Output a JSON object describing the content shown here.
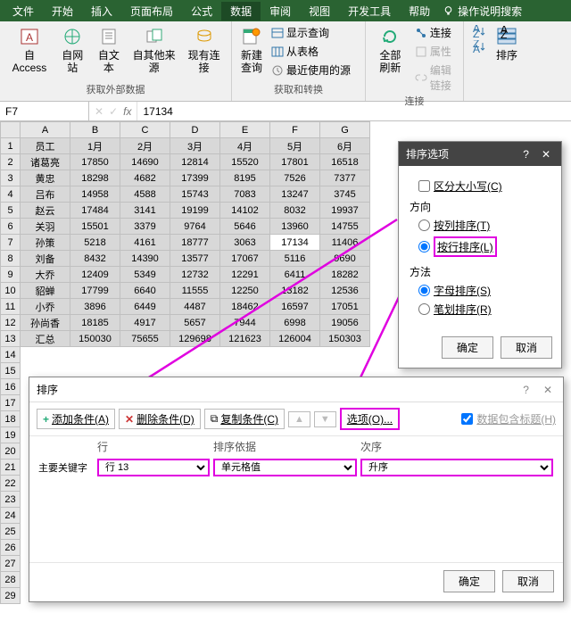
{
  "tabs": [
    "文件",
    "开始",
    "插入",
    "页面布局",
    "公式",
    "数据",
    "审阅",
    "视图",
    "开发工具",
    "帮助"
  ],
  "activeTab": "数据",
  "helpSearch": "操作说明搜索",
  "ribbon": {
    "ext_data": {
      "access": "自 Access",
      "web": "自网站",
      "text": "自文本",
      "other": "自其他来源",
      "existing": "现有连接",
      "label": "获取外部数据"
    },
    "new_query": {
      "btn": "新建\n查询",
      "show": "显示查询",
      "from_table": "从表格",
      "recent": "最近使用的源",
      "label": "获取和转换"
    },
    "refresh": {
      "btn": "全部刷新",
      "conn": "连接",
      "prop": "属性",
      "edit": "编辑链接",
      "label": "连接"
    },
    "sort": {
      "btn": "排序"
    }
  },
  "nameBox": "F7",
  "formulaValue": "17134",
  "columns": [
    "A",
    "B",
    "C",
    "D",
    "E",
    "F",
    "G"
  ],
  "headerRow": [
    "员工",
    "1月",
    "2月",
    "3月",
    "4月",
    "5月",
    "6月"
  ],
  "rows": [
    [
      "诸葛亮",
      17850,
      14690,
      12814,
      15520,
      17801,
      16518
    ],
    [
      "黄忠",
      18298,
      4682,
      17399,
      8195,
      7526,
      7377
    ],
    [
      "吕布",
      14958,
      4588,
      15743,
      7083,
      13247,
      3745
    ],
    [
      "赵云",
      17484,
      3141,
      19199,
      14102,
      8032,
      19937
    ],
    [
      "关羽",
      15501,
      3379,
      9764,
      5646,
      13960,
      14755
    ],
    [
      "孙策",
      5218,
      4161,
      18777,
      3063,
      17134,
      11406
    ],
    [
      "刘备",
      8432,
      14390,
      13577,
      17067,
      5116,
      9690
    ],
    [
      "大乔",
      12409,
      5349,
      12732,
      12291,
      6411,
      18282
    ],
    [
      "貂蝉",
      17799,
      6640,
      11555,
      12250,
      13182,
      12536
    ],
    [
      "小乔",
      3896,
      6449,
      4487,
      18462,
      16597,
      17051
    ],
    [
      "孙尚香",
      18185,
      4917,
      5657,
      7944,
      6998,
      19056
    ],
    [
      "汇总",
      150030,
      75655,
      129698,
      121623,
      126004,
      150303
    ]
  ],
  "highlightCell": {
    "row": 7,
    "col": "F"
  },
  "extraRowNums": [
    14,
    15,
    16,
    17,
    18,
    19,
    20,
    21,
    22,
    23,
    24,
    25,
    26,
    27,
    28,
    29
  ],
  "sortOptions": {
    "title": "排序选项",
    "caseSensitive": "区分大小写(C)",
    "direction": "方向",
    "byCol": "按列排序(T)",
    "byRow": "按行排序(L)",
    "method": "方法",
    "pinyin": "字母排序(S)",
    "stroke": "笔划排序(R)",
    "ok": "确定",
    "cancel": "取消"
  },
  "sortDlg": {
    "title": "排序",
    "addCond": "添加条件(A)",
    "delCond": "删除条件(D)",
    "copyCond": "复制条件(C)",
    "options": "选项(O)...",
    "hasHeader": "数据包含标题(H)",
    "hdr_col": "行",
    "hdr_basis": "排序依据",
    "hdr_order": "次序",
    "primaryKey": "主要关键字",
    "keyVal": "行 13",
    "basisVal": "单元格值",
    "orderVal": "升序",
    "ok": "确定",
    "cancel": "取消"
  }
}
